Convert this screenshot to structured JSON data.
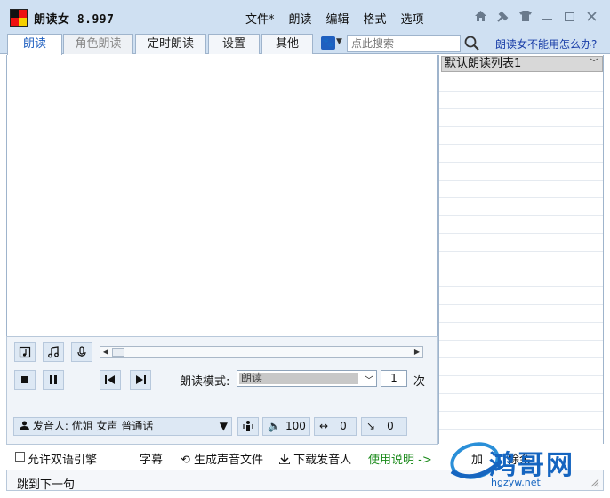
{
  "app": {
    "title": "朗读女 8.997"
  },
  "menu": [
    "文件*",
    "朗读",
    "编辑",
    "格式",
    "选项"
  ],
  "tabs": [
    {
      "label": "朗读",
      "state": "active"
    },
    {
      "label": "角色朗读",
      "state": "disabled"
    },
    {
      "label": "定时朗读",
      "state": "normal"
    },
    {
      "label": "设置",
      "state": "normal"
    },
    {
      "label": "其他",
      "state": "normal"
    }
  ],
  "search": {
    "placeholder": "点此搜索"
  },
  "help_link": "朗读女不能用怎么办?",
  "playlist": {
    "selected": "默认朗读列表1"
  },
  "playback": {
    "mode_label": "朗读模式:",
    "mode_value": "朗读",
    "repeat_count": "1",
    "repeat_unit": "次"
  },
  "voice": {
    "label": "发音人:",
    "value": "优姐 女声 普通话",
    "volume": "100",
    "speed": "0",
    "pitch": "0"
  },
  "options": {
    "bilingual": "允许双语引擎",
    "subtitle": "字幕",
    "generate": "生成声音文件",
    "download": "下载发音人",
    "usage": "使用说明 ->",
    "add": "加",
    "delete": "除余"
  },
  "status": {
    "text": "跳到下一句"
  },
  "watermark": {
    "text": "鸿哥网",
    "url": "hgzyw.net"
  },
  "colors": {
    "title_bg": "#cfe0f2",
    "accent": "#1f5fbf",
    "link": "#1a3ea8",
    "usage": "#1a8a1a"
  }
}
